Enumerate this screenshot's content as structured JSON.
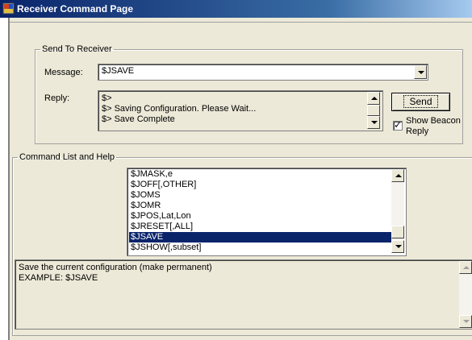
{
  "window": {
    "title": "Receiver Command Page",
    "icon": "app-icon"
  },
  "send_group": {
    "legend": "Send To Receiver",
    "message_label": "Message:",
    "message_value": "$JSAVE",
    "reply_label": "Reply:",
    "reply_lines": [
      "$>",
      "$> Saving Configuration. Please Wait...",
      "$> Save Complete"
    ],
    "send_button": "Send",
    "show_beacon_line1": "Show Beacon",
    "show_beacon_line2": "Reply",
    "show_beacon_checked": true
  },
  "command_group": {
    "legend": "Command List and Help",
    "items": [
      "$JMASK,e",
      "$JOFF[,OTHER]",
      "$JOMS",
      "$JOMR",
      "$JPOS,Lat,Lon",
      "$JRESET[,ALL]",
      "$JSAVE",
      "$JSHOW[,subset]"
    ],
    "selected": "$JSAVE",
    "help_lines": [
      "Save the current configuration (make permanent)",
      "EXAMPLE:  $JSAVE"
    ]
  },
  "colors": {
    "title_start": "#0a246a",
    "title_end": "#a6caf0",
    "selection": "#0a246a",
    "face": "#ece9d8"
  }
}
